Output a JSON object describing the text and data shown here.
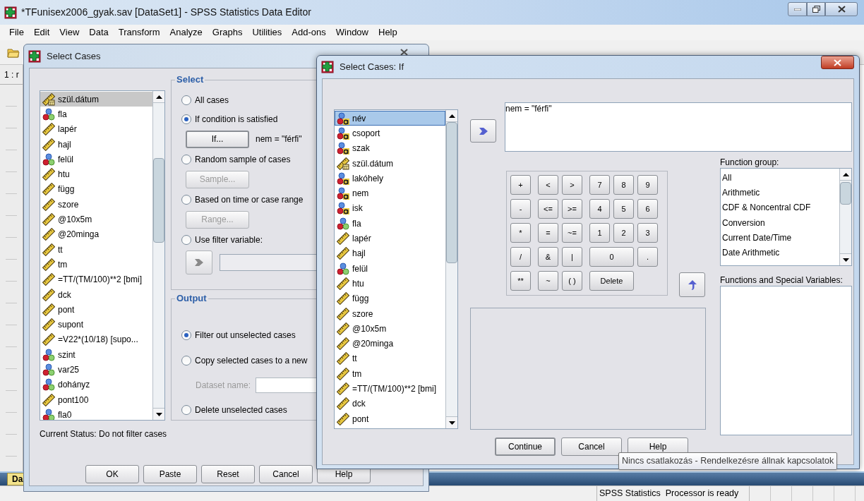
{
  "main_window": {
    "title": "*TFunisex2006_gyak.sav [DataSet1] - SPSS Statistics Data Editor",
    "menu": [
      "File",
      "Edit",
      "View",
      "Data",
      "Transform",
      "Analyze",
      "Graphs",
      "Utilities",
      "Add-ons",
      "Window",
      "Help"
    ],
    "cell_ref": "1 : r",
    "sheet_tab": "Da",
    "status": "SPSS Statistics  Processor is ready"
  },
  "select_cases": {
    "title": "Select Cases",
    "variables": [
      {
        "name": "szül.dátum",
        "kind": "date",
        "selected": true
      },
      {
        "name": "fla",
        "kind": "nominal",
        "selected": false
      },
      {
        "name": "lapér",
        "kind": "scale",
        "selected": false
      },
      {
        "name": "hajl",
        "kind": "scale",
        "selected": false
      },
      {
        "name": "felül",
        "kind": "nominal",
        "selected": false
      },
      {
        "name": "htu",
        "kind": "scale",
        "selected": false
      },
      {
        "name": "függ",
        "kind": "scale",
        "selected": false
      },
      {
        "name": "szore",
        "kind": "scale",
        "selected": false
      },
      {
        "name": "@10x5m",
        "kind": "scale",
        "selected": false
      },
      {
        "name": "@20minga",
        "kind": "scale",
        "selected": false
      },
      {
        "name": "tt",
        "kind": "scale",
        "selected": false
      },
      {
        "name": "tm",
        "kind": "scale",
        "selected": false
      },
      {
        "name": "=TT/(TM/100)**2 [bmi]",
        "kind": "scale",
        "selected": false
      },
      {
        "name": "dck",
        "kind": "scale",
        "selected": false
      },
      {
        "name": "pont",
        "kind": "scale",
        "selected": false
      },
      {
        "name": "supont",
        "kind": "scale",
        "selected": false
      },
      {
        "name": "=V22*(10/18) [supo...",
        "kind": "scale",
        "selected": false
      },
      {
        "name": "szint",
        "kind": "nominal",
        "selected": false
      },
      {
        "name": "var25",
        "kind": "nominal",
        "selected": false
      },
      {
        "name": "dohányz",
        "kind": "nominal",
        "selected": false
      },
      {
        "name": "pont100",
        "kind": "scale",
        "selected": false
      },
      {
        "name": "fla0",
        "kind": "nominal",
        "selected": false
      }
    ],
    "select_group": {
      "title": "Select",
      "options": [
        {
          "kind": "plain",
          "label": "All cases",
          "selected": false
        },
        {
          "kind": "button",
          "label": "If condition is satisfied",
          "selected": true,
          "button": "If...",
          "disabled": false,
          "condition": "nem = \"férfi\""
        },
        {
          "kind": "button",
          "label": "Random sample of cases",
          "selected": false,
          "button": "Sample...",
          "disabled": true
        },
        {
          "kind": "button",
          "label": "Based on time or case range",
          "selected": false,
          "button": "Range...",
          "disabled": true
        },
        {
          "kind": "filter",
          "label": "Use filter variable:",
          "selected": false,
          "disabled": true
        }
      ]
    },
    "output_group": {
      "title": "Output",
      "options": [
        {
          "kind": "plain",
          "label": "Filter out unselected cases",
          "selected": true
        },
        {
          "kind": "dataset",
          "label": "Copy selected cases to a new",
          "selected": false,
          "field_label": "Dataset name:"
        },
        {
          "kind": "plain",
          "label": "Delete unselected cases",
          "selected": false
        }
      ]
    },
    "current_status": "Current Status: Do not filter cases",
    "buttons": [
      "OK",
      "Paste",
      "Reset",
      "Cancel",
      "Help"
    ]
  },
  "if_dialog": {
    "title": "Select Cases: If",
    "variables": [
      {
        "name": "név",
        "kind": "string",
        "selected": true
      },
      {
        "name": "csoport",
        "kind": "string",
        "selected": false
      },
      {
        "name": "szak",
        "kind": "string",
        "selected": false
      },
      {
        "name": "szül.dátum",
        "kind": "date",
        "selected": false
      },
      {
        "name": "lakóhely",
        "kind": "string",
        "selected": false
      },
      {
        "name": "nem",
        "kind": "string",
        "selected": false
      },
      {
        "name": "isk",
        "kind": "string",
        "selected": false
      },
      {
        "name": "fla",
        "kind": "nominal",
        "selected": false
      },
      {
        "name": "lapér",
        "kind": "scale",
        "selected": false
      },
      {
        "name": "hajl",
        "kind": "scale",
        "selected": false
      },
      {
        "name": "felül",
        "kind": "nominal",
        "selected": false
      },
      {
        "name": "htu",
        "kind": "scale",
        "selected": false
      },
      {
        "name": "függ",
        "kind": "scale",
        "selected": false
      },
      {
        "name": "szore",
        "kind": "scale",
        "selected": false
      },
      {
        "name": "@10x5m",
        "kind": "scale",
        "selected": false
      },
      {
        "name": "@20minga",
        "kind": "scale",
        "selected": false
      },
      {
        "name": "tt",
        "kind": "scale",
        "selected": false
      },
      {
        "name": "tm",
        "kind": "scale",
        "selected": false
      },
      {
        "name": "=TT/(TM/100)**2 [bmi]",
        "kind": "scale",
        "selected": false
      },
      {
        "name": "dck",
        "kind": "scale",
        "selected": false
      },
      {
        "name": "pont",
        "kind": "scale",
        "selected": false
      }
    ],
    "expression": "nem = \"férfi\"",
    "keypad": [
      [
        {
          "label": "+"
        },
        {
          "label": "<"
        },
        {
          "label": ">"
        },
        {
          "label": "7"
        },
        {
          "label": "8"
        },
        {
          "label": "9"
        }
      ],
      [
        {
          "label": "-"
        },
        {
          "label": "<="
        },
        {
          "label": ">="
        },
        {
          "label": "4"
        },
        {
          "label": "5"
        },
        {
          "label": "6"
        }
      ],
      [
        {
          "label": "*"
        },
        {
          "label": "="
        },
        {
          "label": "~="
        },
        {
          "label": "1"
        },
        {
          "label": "2"
        },
        {
          "label": "3"
        }
      ],
      [
        {
          "label": "/"
        },
        {
          "label": "&"
        },
        {
          "label": "|"
        },
        {
          "label": "0",
          "wide": true
        },
        {
          "label": "."
        }
      ],
      [
        {
          "label": "**"
        },
        {
          "label": "~"
        },
        {
          "label": "( )"
        },
        {
          "label": "Delete",
          "wide": true
        }
      ]
    ],
    "function_group_label": "Function group:",
    "function_groups": [
      {
        "label": "All",
        "selected": false
      },
      {
        "label": "Arithmetic",
        "selected": false
      },
      {
        "label": "CDF & Noncentral CDF",
        "selected": false
      },
      {
        "label": "Conversion",
        "selected": false
      },
      {
        "label": "Current Date/Time",
        "selected": false
      },
      {
        "label": "Date Arithmetic",
        "selected": false
      }
    ],
    "functions_label": "Functions and Special Variables:",
    "buttons": [
      {
        "label": "Continue",
        "default": true
      },
      {
        "label": "Cancel",
        "default": false
      },
      {
        "label": "Help",
        "default": false
      }
    ]
  },
  "tooltip": "Nincs csatlakozás - Rendelkezésre állnak kapcsolatok"
}
